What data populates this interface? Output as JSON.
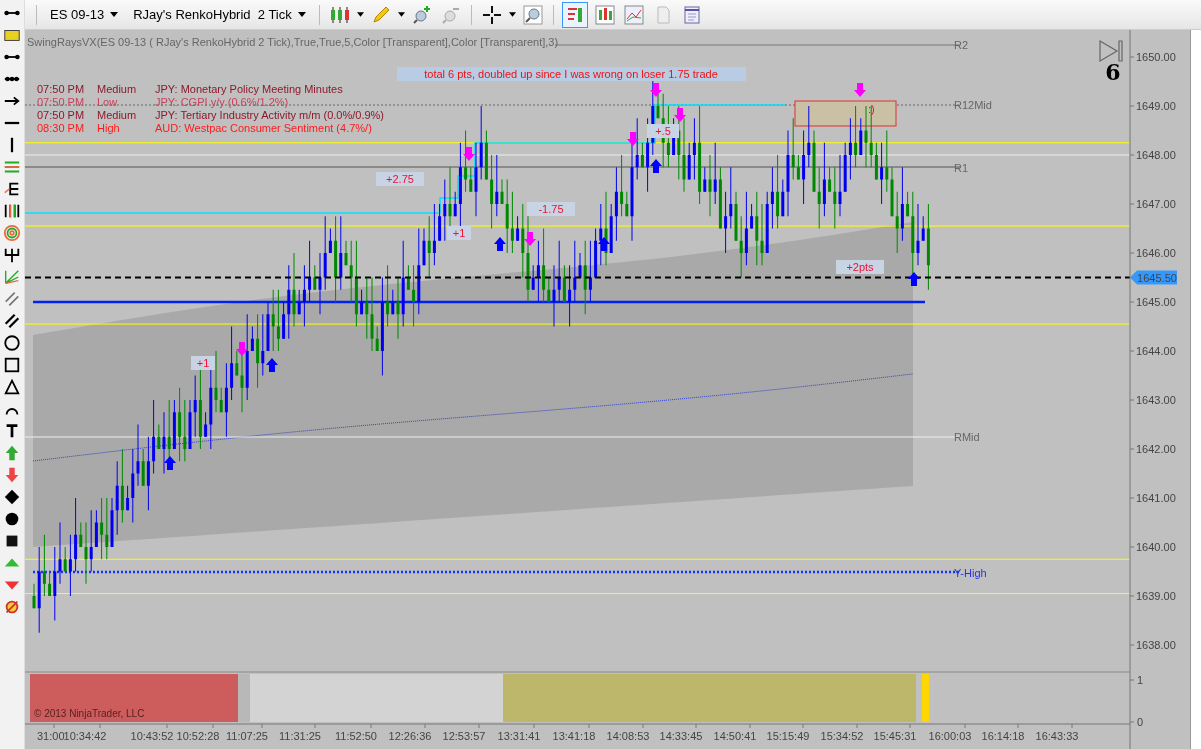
{
  "toolbar": {
    "instrument": "ES 09-13",
    "bar_type": "RJay's RenkoHybrid  2 Tick"
  },
  "chart": {
    "indicator": "SwingRaysVX(ES 09-13 ( RJay's RenkoHybrid  2 Tick),True,True,5,Color [Transparent],Color [Transparent],3)",
    "events": [
      {
        "time": "07:50 PM",
        "impact": "Medium",
        "title": "JPY: Monetary Policy Meeting Minutes",
        "color": "#8b1a2a"
      },
      {
        "time": "07:50 PM",
        "impact": "Low",
        "title": "JPY: CGPI y/y (0.6%/1.2%)",
        "color": "#c8405a"
      },
      {
        "time": "07:50 PM",
        "impact": "Medium",
        "title": "JPY: Tertiary Industry Activity m/m (0.0%/0.9%)",
        "color": "#8b1a2a"
      },
      {
        "time": "08:30 PM",
        "impact": "High",
        "title": "AUD: Westpac Consumer Sentiment (4.7%/)",
        "color": "#ff1a1a"
      }
    ],
    "note": "total 6 pts, doubled up since I was wrong on loser 1.75 trade",
    "trade_labels": [
      "+2.75",
      "-1.75",
      "+.5",
      "+1",
      "+1",
      "+2pts"
    ],
    "smiley": ":)",
    "pivots": [
      "R2",
      "R12Mid",
      "R1",
      "RMid",
      "Y-High"
    ],
    "bar_counter": "6",
    "price_ticks": [
      "1650.00",
      "1649.00",
      "1648.00",
      "1647.00",
      "1646.00",
      "1645.00",
      "1644.00",
      "1643.00",
      "1642.00",
      "1641.00",
      "1640.00",
      "1639.00",
      "1638.00"
    ],
    "last_price": "1645.50",
    "copyright": "© 2013 NinjaTrader, LLC"
  },
  "lower_panel": {
    "ticks": [
      "1",
      "0"
    ]
  },
  "time_axis": [
    "31:00",
    "10:34:42",
    "10:43:52",
    "10:52:28",
    "11:07:25",
    "11:31:25",
    "11:52:50",
    "12:26:36",
    "12:53:57",
    "13:31:41",
    "13:41:18",
    "14:08:53",
    "14:33:45",
    "14:50:41",
    "15:15:49",
    "15:34:52",
    "15:45:31",
    "16:00:03",
    "16:14:18",
    "16:43:33"
  ]
}
